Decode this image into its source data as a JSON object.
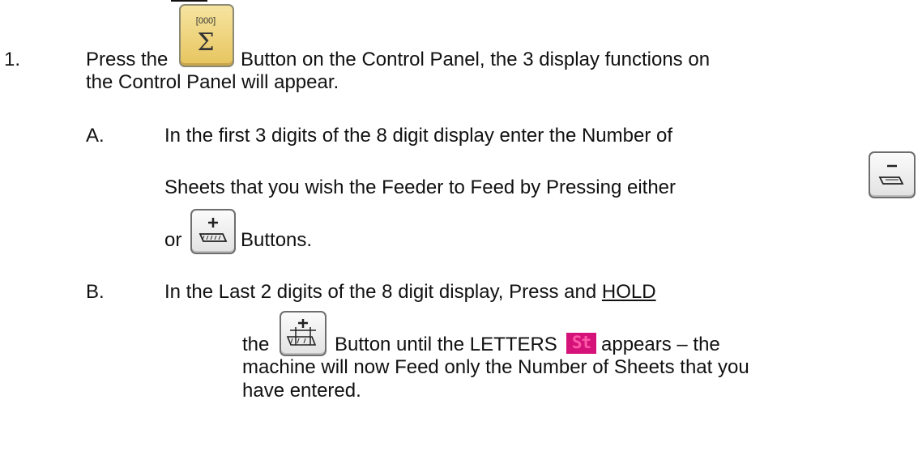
{
  "steps": [
    {
      "number": "1.",
      "text_before_button": "Press the",
      "button_icon": "sigma-counter-button-icon",
      "text_after_button": "Button on the Control Panel, the 3 display functions on",
      "text_line2": "the Control Panel will appear."
    }
  ],
  "substeps": {
    "a": {
      "label": "A.",
      "line1": "In the first 3 digits of the 8 digit display enter the Number of",
      "line2": "Sheets that you wish the Feeder to Feed by Pressing either",
      "button_minus_icon": "minus-sheets-button-icon",
      "or_text": "or",
      "button_plus_icon": "plus-sheets-button-icon",
      "after_plus": "Buttons."
    },
    "b": {
      "label": "B.",
      "line1_pre": "In the Last 2 digits of the 8 digit display, Press and",
      "line1_underlined": "HOLD",
      "the_text": "the",
      "button_icon": "plus-stack-button-icon",
      "after_button": "Button until the LETTERS",
      "display_letters": "St",
      "after_letters": "appears – the",
      "line3": "machine will now Feed only the Number of Sheets that you",
      "line4": "have entered."
    }
  },
  "colors": {
    "text": "#111111",
    "sum_button": "#e7c55e",
    "display_bg": "#d4127a",
    "display_fg": "#ff5aa9"
  }
}
